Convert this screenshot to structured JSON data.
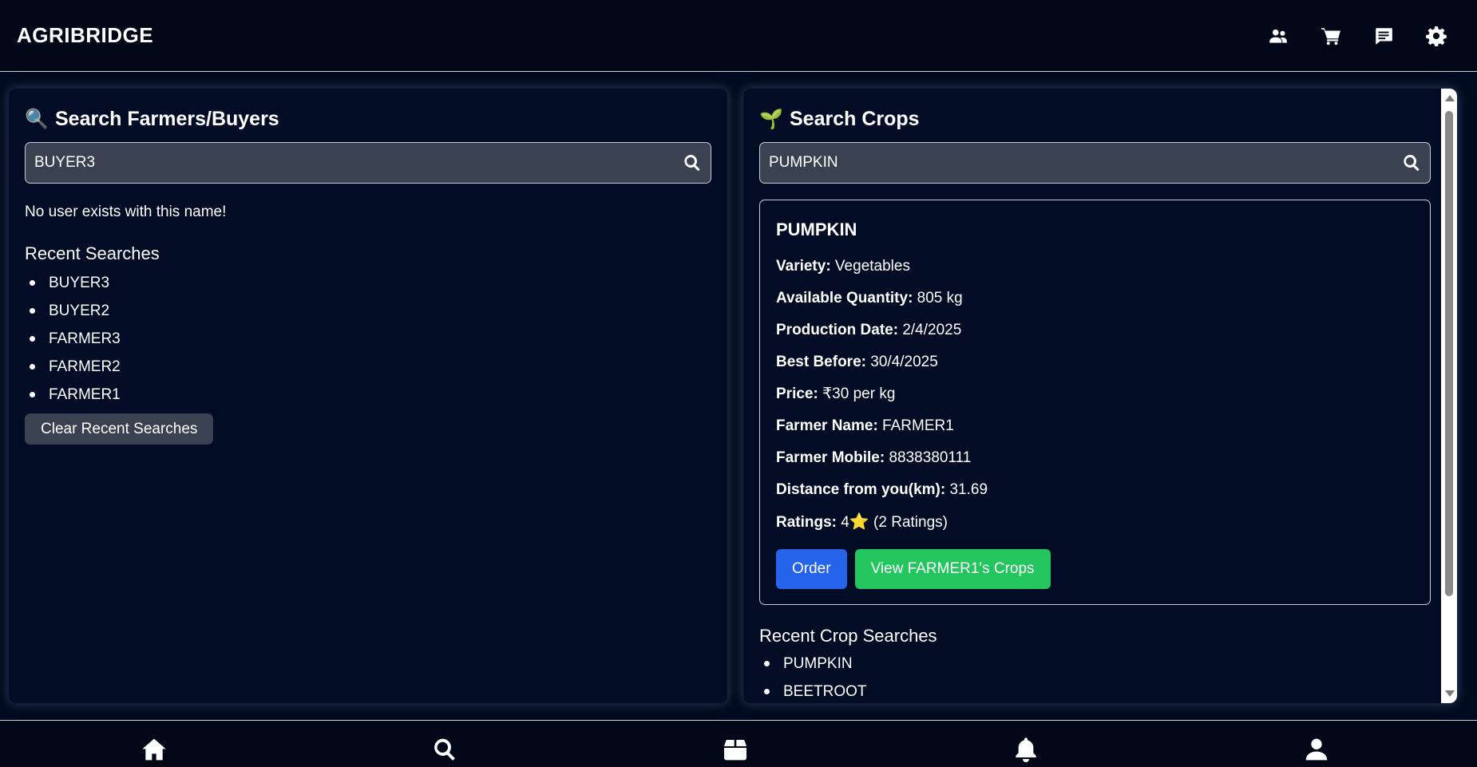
{
  "header": {
    "brand": "AGRIBRIDGE",
    "icons": [
      "users-icon",
      "cart-icon",
      "message-icon",
      "gear-icon"
    ]
  },
  "left_panel": {
    "emoji": "🔍",
    "title": "Search Farmers/Buyers",
    "search_value": "BUYER3",
    "message": "No user exists with this name!",
    "recent_title": "Recent Searches",
    "recent": [
      "BUYER3",
      "BUYER2",
      "FARMER3",
      "FARMER2",
      "FARMER1"
    ],
    "clear_label": "Clear Recent Searches"
  },
  "right_panel": {
    "emoji": "🌱",
    "title": "Search Crops",
    "search_value": "PUMPKIN",
    "crop": {
      "name": "PUMPKIN",
      "fields": [
        {
          "label": "Variety:",
          "value": " Vegetables"
        },
        {
          "label": "Available Quantity:",
          "value": " 805 kg"
        },
        {
          "label": "Production Date:",
          "value": " 2/4/2025"
        },
        {
          "label": "Best Before:",
          "value": " 30/4/2025"
        },
        {
          "label": "Price:",
          "value": " ₹30 per kg"
        },
        {
          "label": "Farmer Name:",
          "value": " FARMER1"
        },
        {
          "label": "Farmer Mobile:",
          "value": " 8838380111"
        },
        {
          "label": "Distance from you(km):",
          "value": " 31.69"
        }
      ],
      "ratings_label": "Ratings:",
      "ratings_value": " 4",
      "ratings_star": "⭐",
      "ratings_count": " (2 Ratings)",
      "order_label": "Order",
      "view_label": "View FARMER1's Crops"
    },
    "recent_title": "Recent Crop Searches",
    "recent": [
      "PUMPKIN",
      "BEETROOT"
    ]
  },
  "bottom_nav": [
    "home-icon",
    "search-icon",
    "box-icon",
    "bell-icon",
    "user-icon"
  ],
  "colors": {
    "background": "#010b1f",
    "order_button": "#2563eb",
    "view_button": "#22c55e",
    "star": "#f7c51e"
  }
}
